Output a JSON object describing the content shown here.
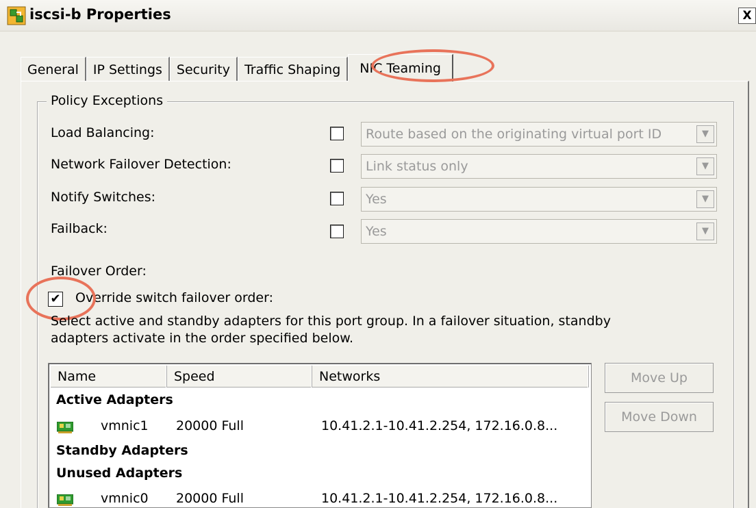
{
  "window": {
    "title": "iscsi-b Properties",
    "close_glyph": "X"
  },
  "tabs": [
    {
      "label": "General"
    },
    {
      "label": "IP Settings"
    },
    {
      "label": "Security"
    },
    {
      "label": "Traffic Shaping"
    },
    {
      "label": "NIC Teaming",
      "active": true
    }
  ],
  "policy": {
    "legend": "Policy Exceptions",
    "rows": [
      {
        "label": "Load Balancing:",
        "checked": false,
        "value": "Route based on the originating virtual port ID"
      },
      {
        "label": "Network Failover Detection:",
        "checked": false,
        "value": "Link status only"
      },
      {
        "label": "Notify Switches:",
        "checked": false,
        "value": "Yes"
      },
      {
        "label": "Failback:",
        "checked": false,
        "value": "Yes"
      }
    ],
    "failover_title": "Failover Order:",
    "override_label": "Override switch failover order:",
    "override_checked": true,
    "override_mark": "✔",
    "description_line1": "Select active and standby adapters for this port group.  In a failover situation, standby",
    "description_line2": "adapters activate  in the order specified below."
  },
  "adapters": {
    "columns": [
      "Name",
      "Speed",
      "Networks"
    ],
    "sections": {
      "active": "Active Adapters",
      "standby": "Standby Adapters",
      "unused": "Unused Adapters"
    },
    "active_rows": [
      {
        "name": "vmnic1",
        "speed": "20000 Full",
        "networks": "10.41.2.1-10.41.2.254, 172.16.0.8..."
      }
    ],
    "unused_rows": [
      {
        "name": "vmnic0",
        "speed": "20000 Full",
        "networks": "10.41.2.1-10.41.2.254, 172.16.0.8..."
      }
    ]
  },
  "buttons": {
    "move_up": "Move Up",
    "move_down": "Move Down"
  },
  "colors": {
    "highlight": "#e8735a",
    "nic_green": "#2f9a2f"
  }
}
